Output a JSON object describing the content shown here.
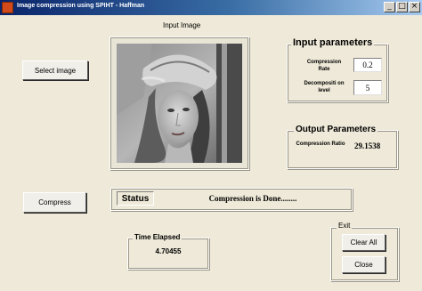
{
  "window": {
    "title": "Image compression using SPIHT - Haffman"
  },
  "buttons": {
    "select_image": "Select image",
    "compress": "Compress",
    "clear_all": "Clear All",
    "close": "Close"
  },
  "input_image": {
    "label": "Input Image"
  },
  "input_parameters": {
    "title": "Input parameters",
    "compression_rate_label": "Compression Rate",
    "compression_rate_value": "0.2",
    "decomposition_level_label": "Decompositi on level",
    "decomposition_level_value": "5"
  },
  "output_parameters": {
    "title": "Output Parameters",
    "compression_ratio_label": "Compression Ratio",
    "compression_ratio_value": "29.1538"
  },
  "status": {
    "label": "Status",
    "text": "Compression is Done........"
  },
  "time_elapsed": {
    "title": "Time Elapsed",
    "value": "4.70455"
  },
  "exit": {
    "title": "Exit"
  },
  "icons": {
    "app": "matlab-figure-icon",
    "minimize": "minimize-icon",
    "maximize": "maximize-icon",
    "close": "close-window-icon"
  }
}
